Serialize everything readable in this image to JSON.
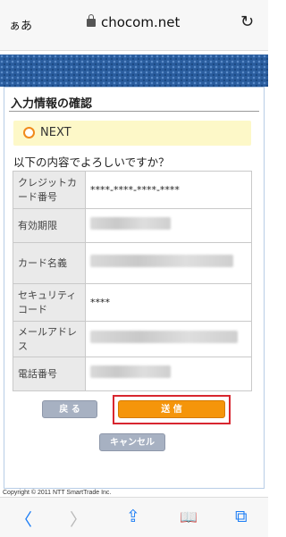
{
  "browser": {
    "text_size_label": "ぁあ",
    "url": "chocom.net",
    "reload_icon": "↻"
  },
  "page": {
    "title": "入力情報の確認",
    "next_label": "NEXT",
    "question": "以下の内容でよろしいですか？",
    "rows": [
      {
        "label": "クレジットカード番号",
        "value": "****-****-****-****",
        "masked": false
      },
      {
        "label": "有効期限",
        "value": "",
        "masked": true
      },
      {
        "label": "カード名義",
        "value": "",
        "masked": true
      },
      {
        "label": "セキュリティコード",
        "value": "****",
        "masked": false
      },
      {
        "label": "メールアドレス",
        "value": "",
        "masked": true
      },
      {
        "label": "電話番号",
        "value": "",
        "masked": true
      }
    ],
    "buttons": {
      "back": "戻 る",
      "send": "送 信",
      "cancel": "キャンセル"
    },
    "copyright": "Copyright © 2011 NTT SmartTrade Inc."
  },
  "toolbar": {
    "back_icon": "〈",
    "forward_icon": "〉",
    "share_icon": "⇪",
    "bookmarks_icon": "📖",
    "tabs_icon": "⧉"
  },
  "colors": {
    "send_button": "#f5950a",
    "highlight_border": "#d8262f",
    "next_bg": "#fdf8c8",
    "header_band": "#2a5d9e"
  }
}
